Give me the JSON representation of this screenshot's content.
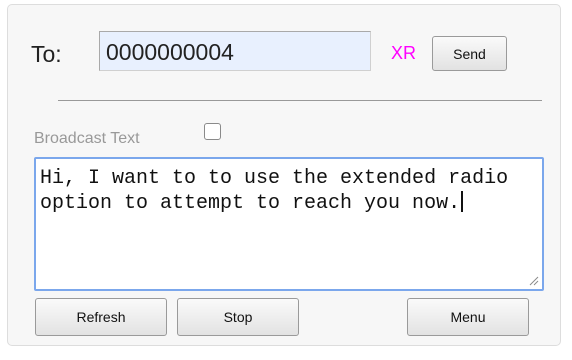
{
  "compose": {
    "to_label": "To:",
    "to_value": "0000000004",
    "xr_label": "XR",
    "send_label": "Send"
  },
  "broadcast": {
    "label": "Broadcast Text",
    "checked": false
  },
  "message": {
    "text": "Hi, I want to to use the extended radio option to attempt to reach you now."
  },
  "actions": {
    "refresh_label": "Refresh",
    "stop_label": "Stop",
    "menu_label": "Menu"
  },
  "colors": {
    "xr": "#ff00ff",
    "input_autofill_bg": "#e8f0fe",
    "focus_border": "#7ba7ec"
  },
  "icons": {
    "resize_grip": "resize-grip-icon"
  }
}
